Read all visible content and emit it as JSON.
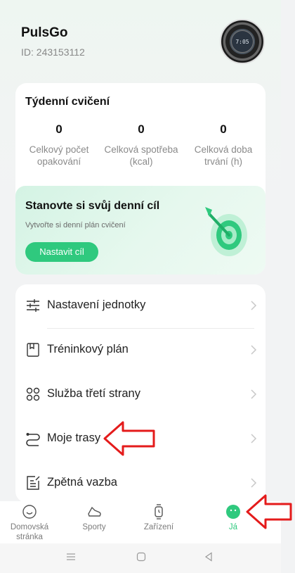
{
  "header": {
    "app_name": "PulsGo",
    "user_id": "ID: 243153112",
    "avatar_face_text": "7:05"
  },
  "weekly": {
    "title": "Týdenní cvičení",
    "stats": [
      {
        "value": "0",
        "label_line1": "Celkový počet",
        "label_line2": "opakování"
      },
      {
        "value": "0",
        "label_line1": "Celková spotřeba",
        "label_line2": "(kcal)"
      },
      {
        "value": "0",
        "label_line1": "Celková doba",
        "label_line2": "trvání (h)"
      }
    ],
    "goal": {
      "title": "Stanovte si svůj denní cíl",
      "subtitle": "Vytvořte si denní plán cvičení",
      "button": "Nastavit cíl"
    }
  },
  "menu": {
    "items": [
      {
        "label": "Nastavení jednotky",
        "icon": "unit-settings-icon"
      },
      {
        "label": "Tréninkový plán",
        "icon": "training-plan-icon"
      },
      {
        "label": "Služba třetí strany",
        "icon": "third-party-icon"
      },
      {
        "label": "Moje trasy",
        "icon": "routes-icon"
      },
      {
        "label": "Zpětná vazba",
        "icon": "feedback-icon"
      }
    ]
  },
  "bottom_nav": {
    "items": [
      {
        "label_line1": "Domovská",
        "label_line2": "stránka",
        "icon": "home-icon",
        "active": false
      },
      {
        "label_line1": "Sporty",
        "label_line2": "",
        "icon": "shoe-icon",
        "active": false
      },
      {
        "label_line1": "Zařízení",
        "label_line2": "",
        "icon": "watch-icon",
        "active": false
      },
      {
        "label_line1": "Já",
        "label_line2": "",
        "icon": "profile-face-icon",
        "active": true
      }
    ]
  },
  "colors": {
    "accent": "#2fc97e",
    "annotation_arrow": "#e41b1b"
  }
}
